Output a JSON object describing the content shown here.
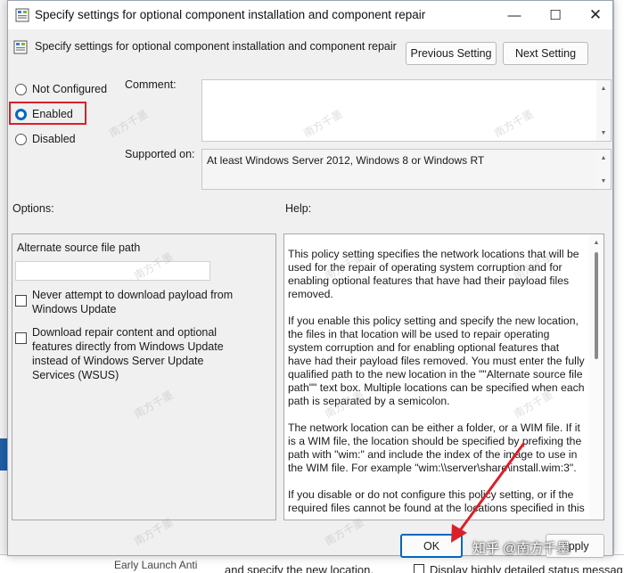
{
  "dialog": {
    "title": "Specify settings for optional component installation and component repair",
    "header": "Specify settings for optional component installation and component repair",
    "prev_button": "Previous Setting",
    "next_button": "Next Setting"
  },
  "state": {
    "options": [
      "Not Configured",
      "Enabled",
      "Disabled"
    ],
    "selected": "Enabled",
    "highlight_color": "#d9202a"
  },
  "comment": {
    "label": "Comment:",
    "value": ""
  },
  "supported": {
    "label": "Supported on:",
    "value": "At least Windows Server 2012, Windows 8 or Windows RT"
  },
  "options_section": {
    "label": "Options:",
    "alt_source_label": "Alternate source file path",
    "alt_source_value": "",
    "checkboxes": [
      {
        "label": "Never attempt to download payload from Windows Update",
        "checked": false
      },
      {
        "label": "Download repair content and optional features directly from Windows Update instead of Windows Server Update Services (WSUS)",
        "checked": false
      }
    ]
  },
  "help_section": {
    "label": "Help:",
    "paragraphs": [
      "This policy setting specifies the network locations that will be used for the repair of operating system corruption and for enabling optional features that have had their payload files removed.",
      "If you enable this policy setting and specify the new location, the files in that location will be used to repair operating system corruption and for enabling optional features that have had their payload files removed. You must enter the fully qualified path to the new location in the \"\"Alternate source file path\"\" text box. Multiple locations can be specified when each path is separated by a semicolon.",
      "The network location can be either a folder, or a WIM file. If it is a WIM file, the location should be specified by prefixing the path with \"wim:\" and include the index of the image to use in the WIM file. For example \"wim:\\\\server\\share\\install.wim:3\".",
      "If you disable or do not configure this policy setting, or if the required files cannot be found at the locations specified in this"
    ]
  },
  "footer": {
    "ok_button": "OK",
    "apply_button": "Apply"
  },
  "background": {
    "bottom_text": "and specify the new location.",
    "bottom_left_text": "Early Launch Anti",
    "bottom_right_text": "Display highly detailed status messag"
  },
  "overlay": {
    "watermark": "南方千墨",
    "zhihu_credit": "知乎 @南方千墨"
  },
  "accent_color": "#0067c0"
}
